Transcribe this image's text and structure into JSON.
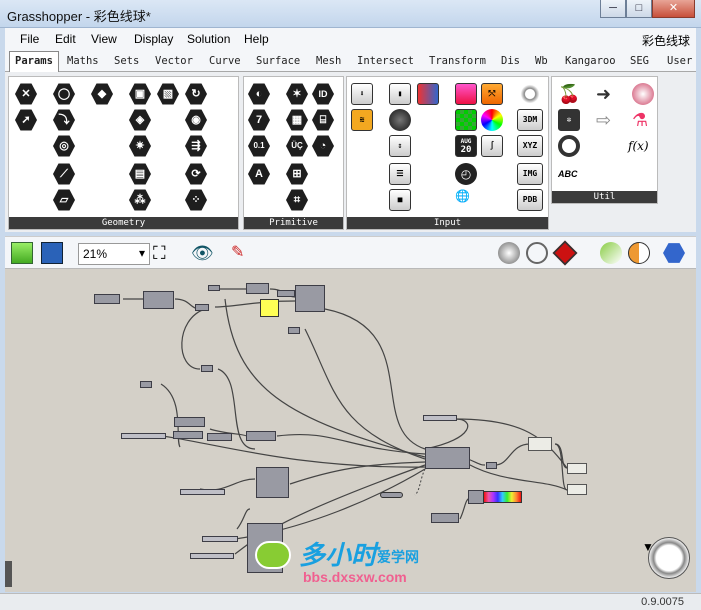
{
  "window": {
    "title": "Grasshopper - 彩色线球*",
    "minimize": "─",
    "maximize": "□",
    "close": "✕"
  },
  "menu": {
    "items": [
      "File",
      "Edit",
      "View",
      "Display",
      "Solution",
      "Help"
    ],
    "document_name": "彩色线球"
  },
  "tabs": {
    "items": [
      "Params",
      "Maths",
      "Sets",
      "Vector",
      "Curve",
      "Surface",
      "Mesh",
      "Intersect",
      "Transform",
      "Dis",
      "Wb",
      "Kangaroo",
      "SEG",
      "User"
    ],
    "active": "Params"
  },
  "ribbon": {
    "panels": [
      {
        "label": "Geometry"
      },
      {
        "label": "Primitive"
      },
      {
        "label": "Input"
      },
      {
        "label": "Util"
      }
    ],
    "icon_text": {
      "seven": "7",
      "zero_one": "0.1",
      "a": "A",
      "id": "ID",
      "ms": "ÜÇ",
      "cal_month": "AUG",
      "cal_day": "20",
      "t3dm": "3DM",
      "xyz": "XYZ",
      "img": "IMG",
      "pdb": "PDB",
      "abc": "ABC",
      "fx": "f(x)",
      "abc_pt": "ABC"
    }
  },
  "toolbar": {
    "zoom": "21%"
  },
  "watermark": {
    "brand": "多小时",
    "sub": "爱学网",
    "url": "bbs.dxsxw.com"
  },
  "status": {
    "version": "0.9.0075"
  }
}
